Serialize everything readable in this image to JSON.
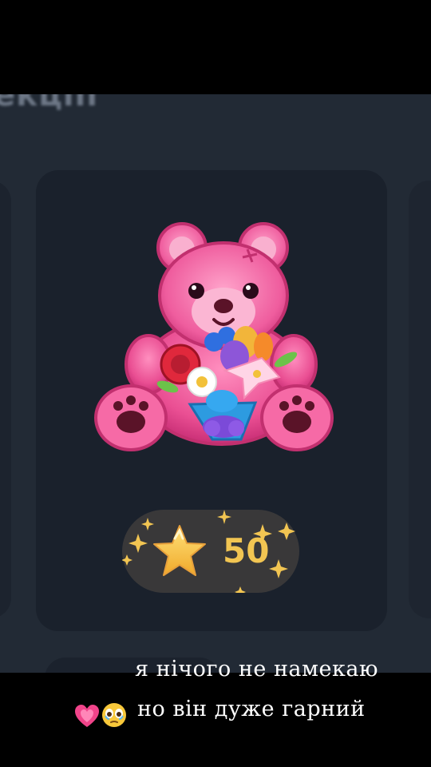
{
  "section": {
    "heading": "екціїї"
  },
  "gift": {
    "icon": "teddy-bear-with-flowers",
    "price_icon": "star-icon",
    "price": "50",
    "colors": {
      "bear": "#ec5b9c",
      "star": "#f2b53a",
      "price_text": "#f2c552"
    }
  },
  "caption": {
    "line1": "я нічого не намекаю",
    "line2": "но він дуже гарний",
    "emoji": [
      "growing-heart-icon",
      "face-holding-back-tears-icon"
    ]
  }
}
